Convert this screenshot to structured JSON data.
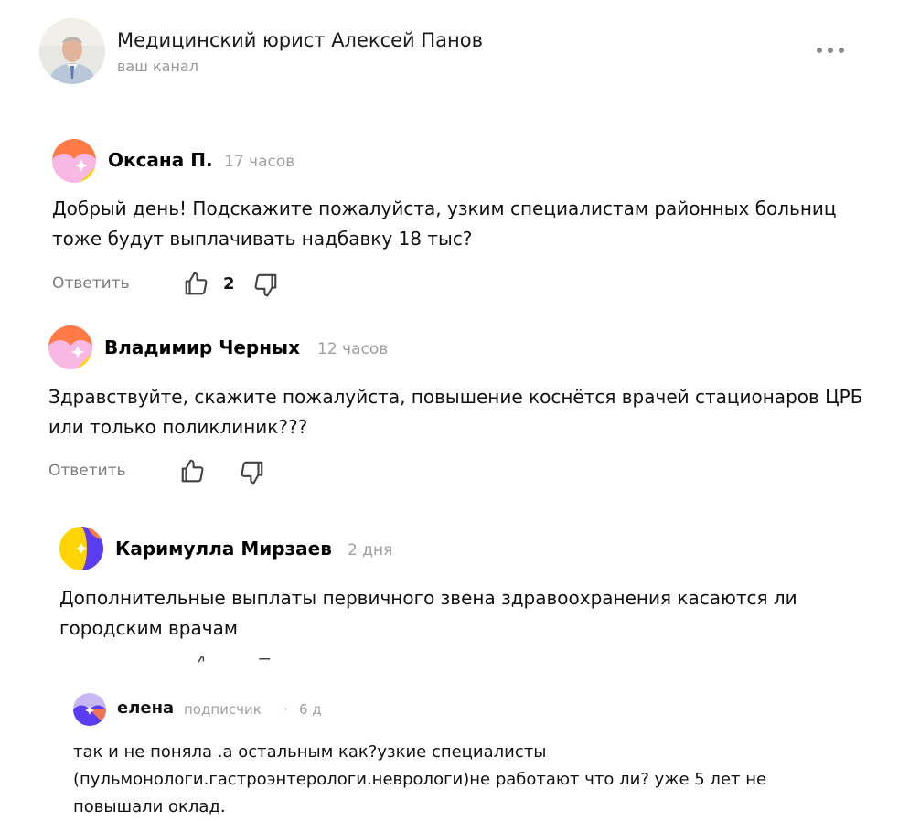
{
  "channel": {
    "title": "Медицинский юрист Алексей Панов",
    "subtitle": "ваш канал"
  },
  "comments": [
    {
      "author": "Оксана П.",
      "time": "17 часов",
      "text": "Добрый день! Подскажите пожалуйста, узким специалистам районных больниц тоже будут выплачивать надбавку 18 тыс?",
      "reply_label": "Ответить",
      "likes": "2"
    },
    {
      "author": "Владимир Черных",
      "time": "12 часов",
      "text": "Здравствуйте, скажите пожалуйста, повышение коснётся врачей стационаров ЦРБ или только поликлиник???",
      "reply_label": "Ответить"
    },
    {
      "author": "Каримулла Мирзаев",
      "time": "2 дня",
      "text": "Дополнительные выплаты первичного звена здравоохранения касаются ли городским врачам"
    },
    {
      "author": "елена",
      "badge": "подписчик",
      "separator": "·",
      "time": "6 д",
      "text": "так и не поняла .а остальным как?узкие специалисты (пульмонологи.гастроэнтерологи.неврологи)не работают что ли? уже 5 лет не повышали оклад."
    }
  ],
  "colors": {
    "avatar_orange": "#ff7a45",
    "avatar_pink": "#f7b9e3",
    "avatar_yellow": "#ffd400",
    "avatar_purple": "#5a3df0",
    "muted_text": "#a0a0a0"
  }
}
